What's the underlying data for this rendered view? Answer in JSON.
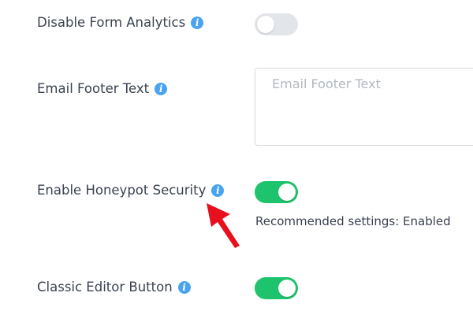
{
  "settings": {
    "disable_analytics": {
      "label": "Disable Form Analytics",
      "enabled": false
    },
    "email_footer": {
      "label": "Email Footer Text",
      "placeholder": "Email Footer Text",
      "value": ""
    },
    "honeypot": {
      "label": "Enable Honeypot Security",
      "enabled": true,
      "help": "Recommended settings: Enabled"
    },
    "classic_editor": {
      "label": "Classic Editor Button",
      "enabled": true
    }
  },
  "icons": {
    "info": "info-icon",
    "annotation": "red-arrow-icon"
  },
  "colors": {
    "toggle_on": "#1ec46d",
    "toggle_off": "#e2e5ea",
    "info_icon": "#4aa3f0",
    "arrow": "#e8101c"
  }
}
